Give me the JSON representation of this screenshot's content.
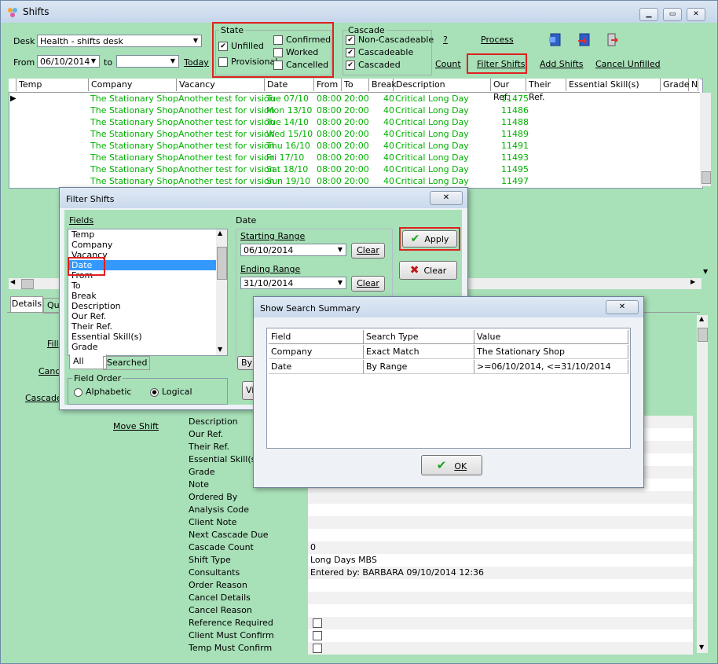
{
  "window": {
    "title": "Shifts"
  },
  "top": {
    "desk_label": "Desk",
    "desk_value": "Health - shifts desk",
    "from_label": "From",
    "from_value": "06/10/2014",
    "to_label": "to",
    "to_value": "",
    "today_link": "Today"
  },
  "state": {
    "legend": "State",
    "unfilled": "Unfilled",
    "provisional": "Provisional",
    "confirmed": "Confirmed",
    "worked": "Worked",
    "cancelled": "Cancelled"
  },
  "cascade": {
    "legend": "Cascade",
    "non_cascadeable": "Non-Cascadeable",
    "cascadeable": "Cascadeable",
    "cascaded": "Cascaded"
  },
  "actions": {
    "help": "?",
    "process": "Process",
    "count": "Count",
    "filter_shifts": "Filter Shifts",
    "add_shifts": "Add Shifts",
    "cancel_unfilled": "Cancel Unfilled"
  },
  "grid": {
    "columns": [
      "Temp",
      "Company",
      "Vacancy",
      "Date",
      "From",
      "To",
      "Break",
      "Description",
      "Our Ref.",
      "Their Ref.",
      "Essential Skill(s)",
      "Grade",
      "N"
    ],
    "rows": [
      {
        "company": "The Stationary Shop",
        "vacancy": "Another test for vision",
        "date": "Tue 07/10",
        "from": "08:00",
        "to": "20:00",
        "break": "40",
        "desc": "Critical Long Day",
        "ref": "11475"
      },
      {
        "company": "The Stationary Shop",
        "vacancy": "Another test for vision",
        "date": "Mon 13/10",
        "from": "08:00",
        "to": "20:00",
        "break": "40",
        "desc": "Critical Long Day",
        "ref": "11486"
      },
      {
        "company": "The Stationary Shop",
        "vacancy": "Another test for vision",
        "date": "Tue 14/10",
        "from": "08:00",
        "to": "20:00",
        "break": "40",
        "desc": "Critical Long Day",
        "ref": "11488"
      },
      {
        "company": "The Stationary Shop",
        "vacancy": "Another test for vision",
        "date": "Wed 15/10",
        "from": "08:00",
        "to": "20:00",
        "break": "40",
        "desc": "Critical Long Day",
        "ref": "11489"
      },
      {
        "company": "The Stationary Shop",
        "vacancy": "Another test for vision",
        "date": "Thu 16/10",
        "from": "08:00",
        "to": "20:00",
        "break": "40",
        "desc": "Critical Long Day",
        "ref": "11491"
      },
      {
        "company": "The Stationary Shop",
        "vacancy": "Another test for vision",
        "date": "Fri 17/10",
        "from": "08:00",
        "to": "20:00",
        "break": "40",
        "desc": "Critical Long Day",
        "ref": "11493"
      },
      {
        "company": "The Stationary Shop",
        "vacancy": "Another test for vision",
        "date": "Sat 18/10",
        "from": "08:00",
        "to": "20:00",
        "break": "40",
        "desc": "Critical Long Day",
        "ref": "11495"
      },
      {
        "company": "The Stationary Shop",
        "vacancy": "Another test for vision",
        "date": "Sun 19/10",
        "from": "08:00",
        "to": "20:00",
        "break": "40",
        "desc": "Critical Long Day",
        "ref": "11497"
      }
    ]
  },
  "tabs": {
    "details": "Details",
    "qu": "Qu"
  },
  "left_links": {
    "fill": "Fill",
    "cancel": "Canc",
    "cascade": "Cascade",
    "move_shift": "Move Shift"
  },
  "details": {
    "labels": [
      "Description",
      "Our Ref.",
      "Their Ref.",
      "Essential Skill(s)",
      "Grade",
      "Note",
      "Ordered By",
      "Analysis Code",
      "Client Note",
      "Next Cascade Due",
      "Cascade Count",
      "Shift Type",
      "Consultants",
      "Order Reason",
      "Cancel Details",
      "Cancel Reason",
      "Reference Required",
      "Client Must Confirm",
      "Temp Must Confirm"
    ],
    "cascade_count": "0",
    "shift_type": "Long Days MBS",
    "consultants": "Entered by: BARBARA 09/10/2014 12:36"
  },
  "filter_dialog": {
    "title": "Filter Shifts",
    "fields_label": "Fields",
    "fields": [
      "Temp",
      "Company",
      "Vacancy",
      "Date",
      "From",
      "To",
      "Break",
      "Description",
      "Our Ref.",
      "Their Ref.",
      "Essential Skill(s)",
      "Grade"
    ],
    "selected_field": "Date",
    "tab_all": "All",
    "tab_searched": "Searched",
    "field_order_label": "Field Order",
    "alphabetic": "Alphabetic",
    "logical": "Logical",
    "date_label": "Date",
    "starting_range_label": "Starting Range",
    "starting_range_value": "06/10/2014",
    "ending_range_label": "Ending Range",
    "ending_range_value": "31/10/2014",
    "clear": "Clear",
    "apply": "Apply",
    "clear_all": "Clear",
    "by_partial": "By",
    "vi_partial": "Vi"
  },
  "summary_dialog": {
    "title": "Show Search Summary",
    "headers": [
      "Field",
      "Search Type",
      "Value"
    ],
    "rows": [
      [
        "Company",
        "Exact Match",
        "The Stationary Shop"
      ],
      [
        "Date",
        "By Range",
        ">=06/10/2014, <=31/10/2014"
      ]
    ],
    "ok": "OK"
  }
}
